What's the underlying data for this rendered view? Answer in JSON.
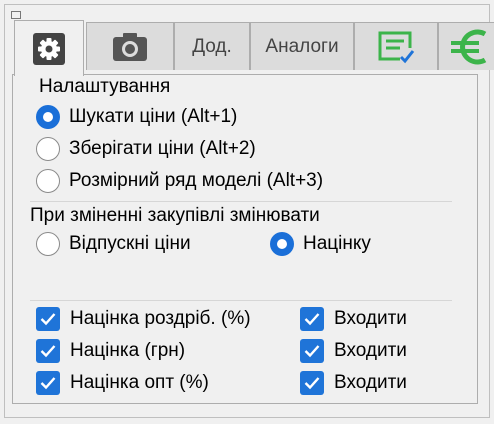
{
  "tabs": [
    {
      "icon": "gear-icon",
      "active": true
    },
    {
      "icon": "camera-icon",
      "active": false
    },
    {
      "label": "Дод.",
      "active": false
    },
    {
      "label": "Аналоги",
      "active": false
    },
    {
      "icon": "checklist-icon",
      "active": false
    },
    {
      "icon": "euro-icon",
      "active": false
    }
  ],
  "settings": {
    "title": "Налаштування",
    "options": [
      {
        "label": "Шукати ціни (Alt+1)",
        "checked": true
      },
      {
        "label": "Зберігати ціни (Alt+2)",
        "checked": false
      },
      {
        "label": "Розмірний ряд моделі (Alt+3)",
        "checked": false
      }
    ]
  },
  "purchase_change": {
    "title": "При зміненні закупівлі змінювати",
    "options": [
      {
        "label": "Відпускні ціни",
        "checked": false
      },
      {
        "label": "Націнку",
        "checked": true
      }
    ]
  },
  "markups": [
    {
      "label": "Націнка роздріб. (%)",
      "checked": true,
      "include_label": "Входити",
      "include_checked": true
    },
    {
      "label": "Націнка (грн)",
      "checked": true,
      "include_label": "Входити",
      "include_checked": true
    },
    {
      "label": "Націнка опт (%)",
      "checked": true,
      "include_label": "Входити",
      "include_checked": true
    }
  ],
  "colors": {
    "accent": "#1f74d8",
    "icon_green": "#3cb44a"
  }
}
